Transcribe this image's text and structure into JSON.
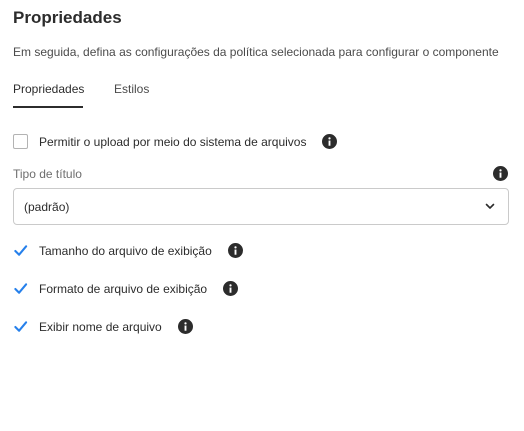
{
  "header": {
    "title": "Propriedades",
    "description": "Em seguida, defina as configurações da política selecionada para configurar o componente"
  },
  "tabs": [
    {
      "label": "Propriedades",
      "active": true
    },
    {
      "label": "Estilos",
      "active": false
    }
  ],
  "options": {
    "upload": {
      "label": "Permitir o upload por meio do sistema de arquivos",
      "checked": false
    },
    "file_size": {
      "label": "Tamanho do arquivo de exibição",
      "checked": true
    },
    "file_format": {
      "label": "Formato de arquivo de exibição",
      "checked": true
    },
    "file_name": {
      "label": "Exibir nome de arquivo",
      "checked": true
    }
  },
  "title_type": {
    "label": "Tipo de título",
    "value": "(padrão)"
  },
  "icons": {
    "info": "info-icon",
    "check": "checkmark-icon",
    "chevron": "chevron-down-icon"
  },
  "colors": {
    "check": "#2680eb",
    "info": "#2c2c2c"
  }
}
